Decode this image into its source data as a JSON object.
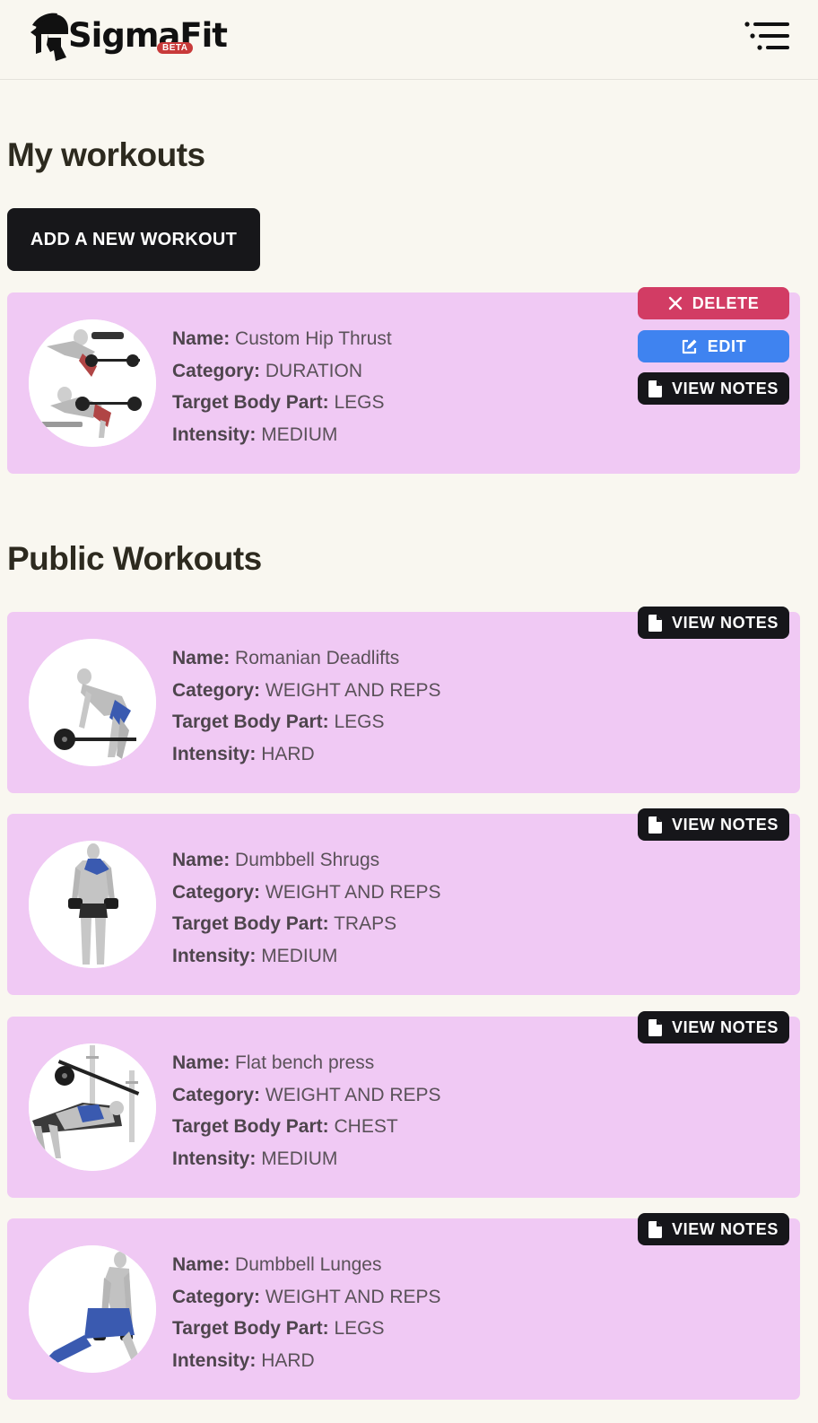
{
  "brand": {
    "name": "SigmaFit",
    "badge": "BETA"
  },
  "icons": {
    "menu": "menu-icon",
    "delete": "x-icon",
    "edit": "edit-icon",
    "notes": "document-icon"
  },
  "colors": {
    "card": "#f0c9f4",
    "delete": "#d23c64",
    "edit": "#3f83f0",
    "dark": "#16161a"
  },
  "my_workouts": {
    "title": "My workouts",
    "add_button": "ADD A NEW WORKOUT",
    "items": [
      {
        "name": "Custom Hip Thrust",
        "category": "DURATION",
        "target": "LEGS",
        "intensity": "MEDIUM",
        "delete_label": "DELETE",
        "edit_label": "EDIT",
        "notes_label": "VIEW NOTES"
      }
    ]
  },
  "public_workouts": {
    "title": "Public Workouts",
    "items": [
      {
        "name": "Romanian Deadlifts",
        "category": "WEIGHT AND REPS",
        "target": "LEGS",
        "intensity": "HARD",
        "notes_label": "VIEW NOTES"
      },
      {
        "name": "Dumbbell Shrugs",
        "category": "WEIGHT AND REPS",
        "target": "TRAPS",
        "intensity": "MEDIUM",
        "notes_label": "VIEW NOTES"
      },
      {
        "name": "Flat bench press",
        "category": "WEIGHT AND REPS",
        "target": "CHEST",
        "intensity": "MEDIUM",
        "notes_label": "VIEW NOTES"
      },
      {
        "name": "Dumbbell Lunges",
        "category": "WEIGHT AND REPS",
        "target": "LEGS",
        "intensity": "HARD",
        "notes_label": "VIEW NOTES"
      }
    ]
  },
  "labels": {
    "name": "Name:",
    "category": "Category:",
    "target": "Target Body Part:",
    "intensity": "Intensity:"
  }
}
